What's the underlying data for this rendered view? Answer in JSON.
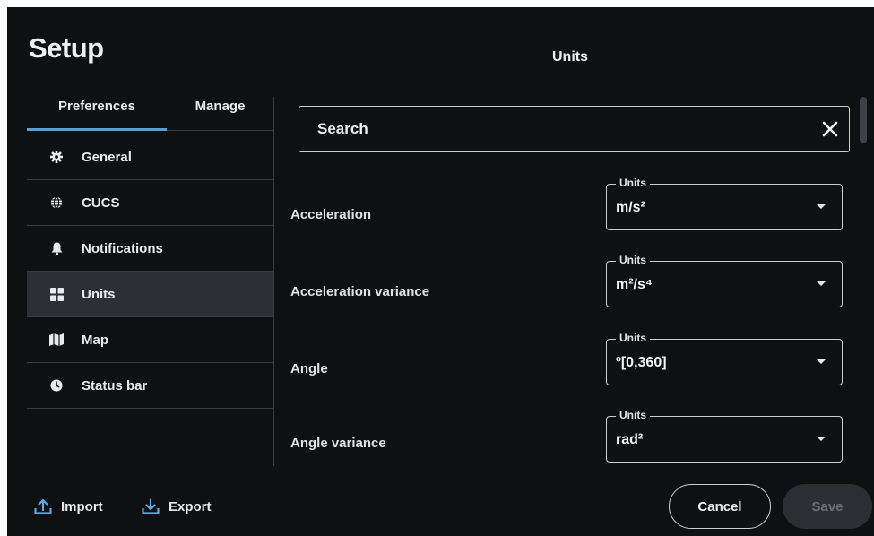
{
  "title": "Setup",
  "section_title": "Units",
  "tabs": [
    {
      "label": "Preferences",
      "active": true
    },
    {
      "label": "Manage",
      "active": false
    }
  ],
  "nav": {
    "items": [
      {
        "label": "General",
        "icon": "gear-icon"
      },
      {
        "label": "CUCS",
        "icon": "globe-icon"
      },
      {
        "label": "Notifications",
        "icon": "bell-icon"
      },
      {
        "label": "Units",
        "icon": "grid-icon",
        "active": true
      },
      {
        "label": "Map",
        "icon": "map-icon"
      },
      {
        "label": "Status bar",
        "icon": "clock-icon"
      }
    ]
  },
  "search": {
    "value": "Search"
  },
  "rows": [
    {
      "label": "Acceleration",
      "field_label": "Units",
      "value": "m/s²"
    },
    {
      "label": "Acceleration variance",
      "field_label": "Units",
      "value": "m²/s⁴"
    },
    {
      "label": "Angle",
      "field_label": "Units",
      "value": "º[0,360]"
    },
    {
      "label": "Angle variance",
      "field_label": "Units",
      "value": "rad²"
    }
  ],
  "footer": {
    "import_label": "Import",
    "export_label": "Export",
    "cancel_label": "Cancel",
    "save_label": "Save"
  },
  "colors": {
    "background": "#0f1012",
    "accent": "#4fa3e0",
    "active_item": "#2c2f34",
    "save_disabled": "#2b2e33"
  }
}
